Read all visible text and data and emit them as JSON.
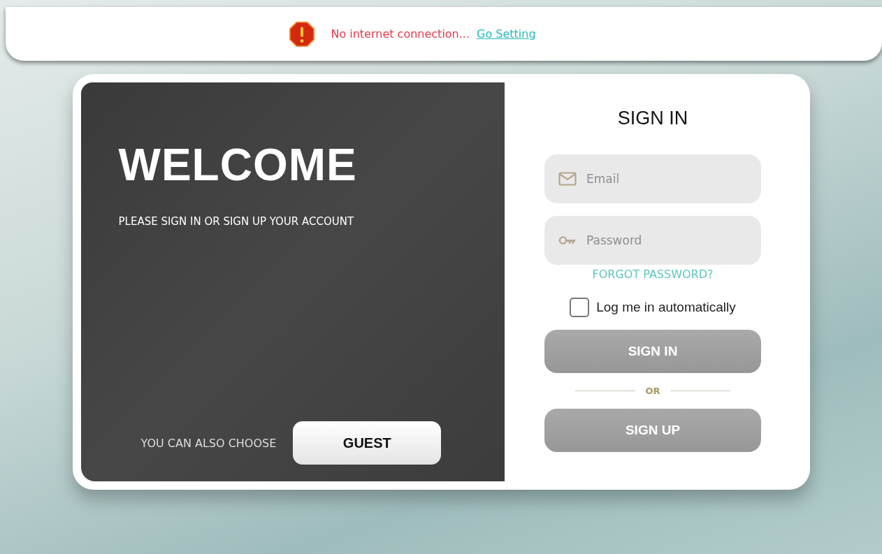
{
  "banner": {
    "message": "No internet connection...",
    "link": "Go Setting"
  },
  "welcome": {
    "title": "WELCOME",
    "subtitle": "PLEASE SIGN IN OR SIGN UP YOUR ACCOUNT",
    "guest_prompt": "YOU CAN ALSO CHOOSE",
    "guest_button": "GUEST"
  },
  "sign_in": {
    "title": "SIGN IN",
    "fields": [
      {
        "kind": "email",
        "placeholder": "Email"
      },
      {
        "kind": "password",
        "placeholder": "Password"
      }
    ],
    "forgot_link": "FORGOT PASSWORD?",
    "remember": {
      "label": "Log me in automatically",
      "checked": false
    },
    "sign_in_button": {
      "label": "SIGN IN",
      "disabled": true
    },
    "divider": "OR",
    "sign_up_button": {
      "label": "SIGN UP",
      "disabled": true
    }
  }
}
